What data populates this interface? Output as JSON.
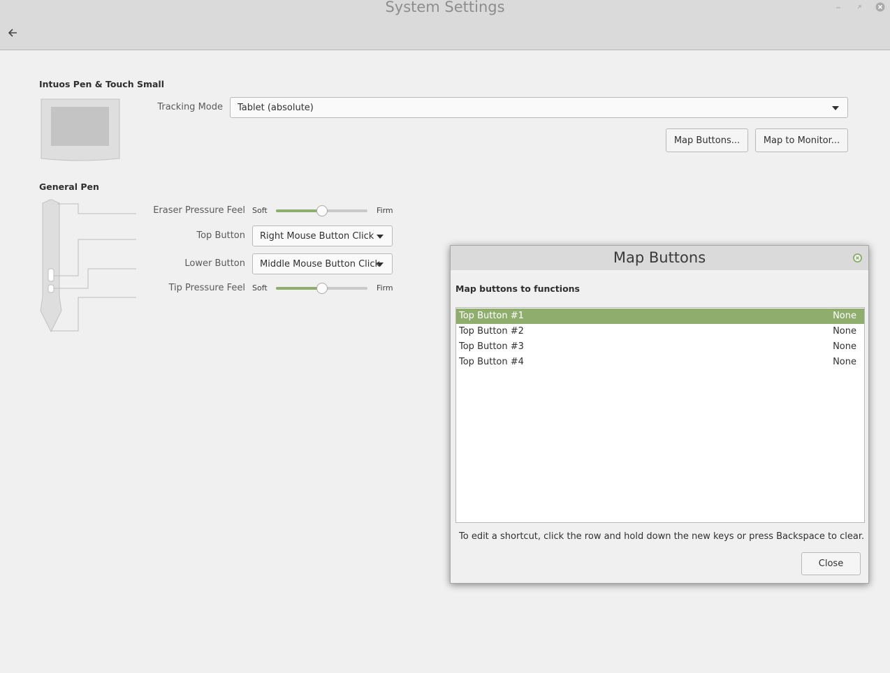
{
  "window": {
    "title": "System Settings"
  },
  "tablet": {
    "name": "Intuos Pen & Touch Small",
    "tracking_mode_label": "Tracking Mode",
    "tracking_mode_value": "Tablet (absolute)",
    "map_buttons_label": "Map Buttons...",
    "map_monitor_label": "Map to Monitor..."
  },
  "pen": {
    "section_title": "General Pen",
    "eraser_label": "Eraser Pressure Feel",
    "eraser_level": 0.5,
    "top_button_label": "Top Button",
    "top_button_value": "Right Mouse Button Click",
    "lower_button_label": "Lower Button",
    "lower_button_value": "Middle Mouse Button Click",
    "tip_label": "Tip Pressure Feel",
    "tip_level": 0.5,
    "soft_label": "Soft",
    "firm_label": "Firm"
  },
  "dialog": {
    "title": "Map Buttons",
    "subtitle": "Map buttons to functions",
    "rows": [
      {
        "name": "Top Button #1",
        "value": "None",
        "selected": true
      },
      {
        "name": "Top Button #2",
        "value": "None",
        "selected": false
      },
      {
        "name": "Top Button #3",
        "value": "None",
        "selected": false
      },
      {
        "name": "Top Button #4",
        "value": "None",
        "selected": false
      }
    ],
    "hint": "To edit a shortcut, click the row and hold down the new keys or press Backspace to clear.",
    "close_label": "Close"
  },
  "colors": {
    "accent": "#8fae6d",
    "titlebar": "#dadada",
    "background": "#f0f0f0"
  },
  "icons": [
    "back-arrow-icon",
    "minimize-icon",
    "maximize-icon",
    "close-icon",
    "dropdown-caret-icon",
    "dialog-close-icon"
  ]
}
